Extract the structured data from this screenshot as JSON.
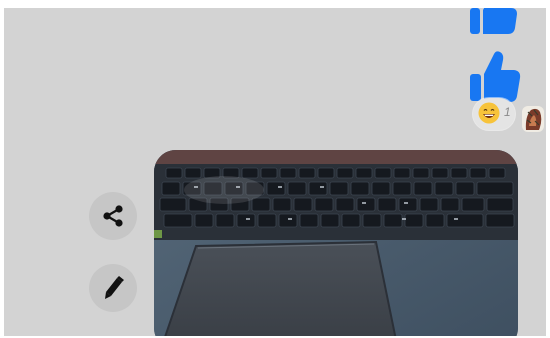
{
  "reactions": {
    "count": "1",
    "emoji_icon": "grinning-emoji-icon"
  },
  "icons": {
    "like_top": "thumbs-up-icon",
    "like_main": "thumbs-up-icon",
    "share": "share-icon",
    "edit": "pencil-icon"
  },
  "colors": {
    "messenger_blue": "#1877f2",
    "background": "#d3d3d3",
    "button_bg": "#c6c6c6"
  },
  "photo": {
    "subject": "laptop-keyboard-photo"
  }
}
